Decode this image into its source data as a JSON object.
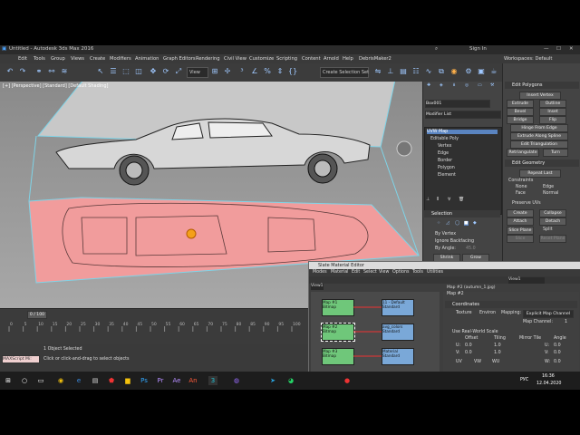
{
  "window": {
    "title": "Untitled - Autodesk 3ds Max 2016"
  },
  "top_right": {
    "search_label": "Sign In",
    "workspace_label": "Workspaces: Default"
  },
  "menu": [
    "Edit",
    "Tools",
    "Group",
    "Views",
    "Create",
    "Modifiers",
    "Animation",
    "Graph Editors",
    "Rendering",
    "Civil View",
    "Customize",
    "Scripting",
    "Content",
    "Arnold",
    "Help",
    "DebrisMaker2"
  ],
  "toolbar": {
    "view_select": "View",
    "selection_set": "Create Selection Set"
  },
  "viewport": {
    "label": "[+] [Perspective] [Standard] [Default Shading]"
  },
  "command_panel": {
    "object_name": "Box001",
    "modifier_list": "Modifier List",
    "stack": [
      "UVW Map",
      "Editable Poly",
      "Vertex",
      "Edge",
      "Border",
      "Polygon",
      "Element"
    ],
    "selection_title": "Selection",
    "selection_options": [
      "By Vertex",
      "Ignore Backfacing",
      "By Angle:"
    ],
    "angle_value": "45.0",
    "shrink": "Shrink",
    "grow": "Grow",
    "ring": "Ring",
    "loop": "Loop"
  },
  "edit_panel": {
    "edit_polygons_title": "Edit Polygons",
    "insert_vertex": "Insert Vertex",
    "buttons": [
      "Extrude",
      "Outline",
      "Bevel",
      "Inset",
      "Bridge",
      "Flip"
    ],
    "hinge": "Hinge From Edge",
    "extrude_spline": "Extrude Along Spline",
    "edit_triangulation": "Edit Triangulation",
    "retriangulate": "Retriangulate",
    "turn": "Turn",
    "edit_geometry_title": "Edit Geometry",
    "repeat_last": "Repeat Last",
    "constraints": "Constraints",
    "constraint_opts": [
      "None",
      "Edge",
      "Face",
      "Normal"
    ],
    "preserve_uvs": "Preserve UVs",
    "create": "Create",
    "collapse": "Collapse",
    "attach": "Attach",
    "detach": "Detach",
    "slice_plane": "Slice Plane",
    "split": "Split",
    "slice": "Slice",
    "reset_plane": "Reset Plane"
  },
  "timeline": {
    "frame": "0 / 100",
    "ticks": [
      "0",
      "5",
      "10",
      "15",
      "20",
      "25",
      "30",
      "35",
      "40",
      "45",
      "50",
      "55",
      "60",
      "65",
      "70",
      "75",
      "80",
      "85",
      "90",
      "95",
      "100"
    ]
  },
  "status": {
    "selected": "1 Object Selected",
    "prompt": "Click or click-and-drag to select objects",
    "maxscript": "MAXScript Mi:"
  },
  "material_editor": {
    "title": "Slate Material Editor",
    "menu": [
      "Modes",
      "Material",
      "Edit",
      "Select",
      "View",
      "Options",
      "Tools",
      "Utilities"
    ],
    "view_tab": "View1",
    "map_path": "Map #2 (autumn_1.jpg)",
    "map_label": "Map #2",
    "nodes": [
      {
        "title": "Map #1",
        "sub": "Bitmap"
      },
      {
        "title": "Map #2",
        "sub": "Bitmap"
      },
      {
        "title": "Map #3",
        "sub": "Bitmap"
      },
      {
        "title": "11 - Default",
        "sub": "Standard"
      },
      {
        "title": "avg_colors",
        "sub": "Standard"
      },
      {
        "title": "Material",
        "sub": "Standard"
      }
    ],
    "coordinates_title": "Coordinates",
    "texture_label": "Texture",
    "environ_label": "Environ",
    "mapping_label": "Mapping:",
    "mapping_value": "Explicit Map Channel",
    "map_channel_label": "Map Channel:",
    "map_channel_value": "1",
    "use_real_world": "Use Real-World Scale",
    "offset": "Offset",
    "tiling": "Tiling",
    "mirror_tile": "Mirror Tile",
    "angle": "Angle",
    "u_label": "U:",
    "v_label": "V:",
    "w_label": "W:",
    "u_offset": "0.0",
    "v_offset": "0.0",
    "u_tiling": "1.0",
    "v_tiling": "1.0",
    "u_angle": "0.0",
    "v_angle": "0.0",
    "w_angle": "0.0",
    "uv_opts": [
      "UV",
      "VW",
      "WU"
    ]
  },
  "taskbar": {
    "lang": "РУС",
    "time": "16:36",
    "date": "12.04.2020"
  }
}
